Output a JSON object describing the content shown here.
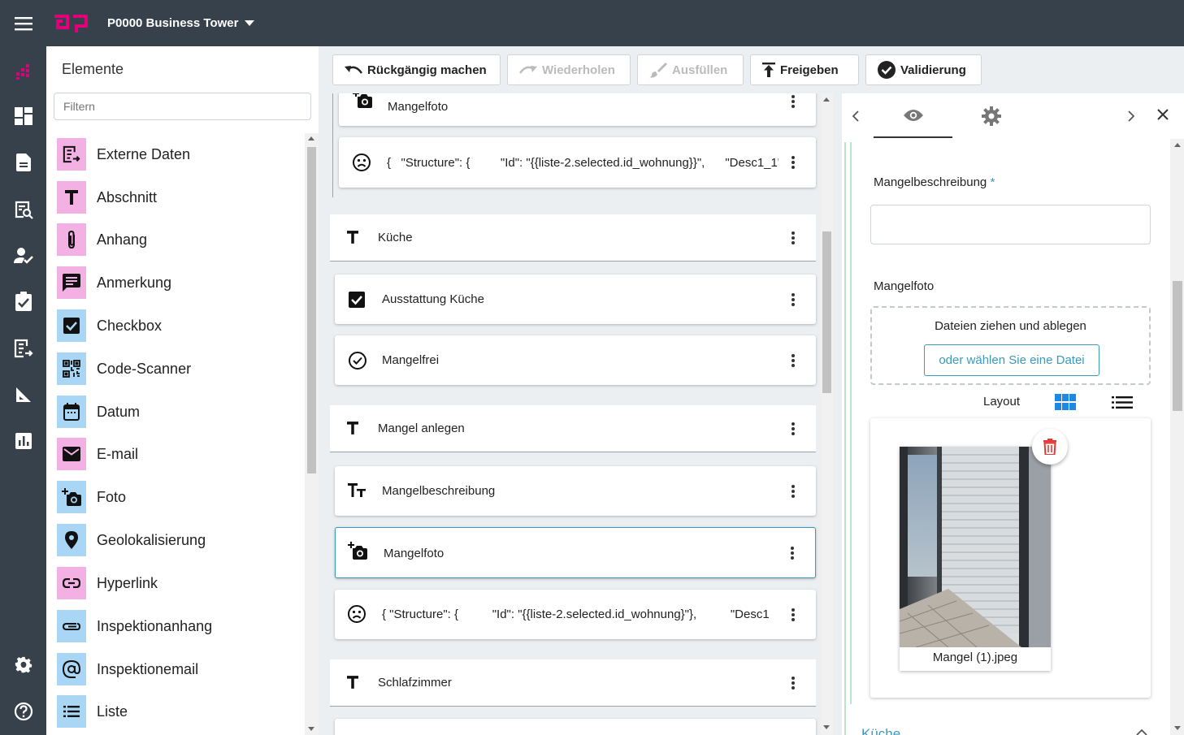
{
  "header": {
    "project": "P0000 Business Tower"
  },
  "elements_panel": {
    "title": "Elemente",
    "filter_placeholder": "Filtern",
    "items": [
      {
        "label": "Externe Daten",
        "icon": "external-data-icon",
        "color": "pink"
      },
      {
        "label": "Abschnitt",
        "icon": "text-t-icon",
        "color": "pink"
      },
      {
        "label": "Anhang",
        "icon": "paperclip-icon",
        "color": "pink"
      },
      {
        "label": "Anmerkung",
        "icon": "comment-icon",
        "color": "pink"
      },
      {
        "label": "Checkbox",
        "icon": "checkbox-icon",
        "color": "blue"
      },
      {
        "label": "Code-Scanner",
        "icon": "qr-code-icon",
        "color": "blue"
      },
      {
        "label": "Datum",
        "icon": "calendar-icon",
        "color": "blue"
      },
      {
        "label": "E-mail",
        "icon": "mail-icon",
        "color": "pink"
      },
      {
        "label": "Foto",
        "icon": "add-photo-icon",
        "color": "blue"
      },
      {
        "label": "Geolokalisierung",
        "icon": "map-pin-icon",
        "color": "blue"
      },
      {
        "label": "Hyperlink",
        "icon": "link-icon",
        "color": "pink"
      },
      {
        "label": "Inspektionanhang",
        "icon": "attachment-icon",
        "color": "blue"
      },
      {
        "label": "Inspektionemail",
        "icon": "at-icon",
        "color": "blue"
      },
      {
        "label": "Liste",
        "icon": "list-icon",
        "color": "blue"
      }
    ]
  },
  "toolbar": {
    "undo": "Rückgängig machen",
    "redo": "Wiederholen",
    "fill": "Ausfüllen",
    "release": "Freigeben",
    "validate": "Validierung"
  },
  "form": {
    "items": [
      {
        "label": "Mangelfoto",
        "icon": "add-photo-icon"
      },
      {
        "label": "{   \"Structure\": {         \"Id\": \"{{liste-2.selected.id_wohnung}}\",      \"Desc1_1\"",
        "icon": "sad-face-icon"
      },
      {
        "label": "Küche",
        "icon": "text-t-icon"
      },
      {
        "label": "Ausstattung Küche",
        "icon": "checkbox-icon"
      },
      {
        "label": "Mangelfrei",
        "icon": "check-circle-icon"
      },
      {
        "label": "Mangel anlegen",
        "icon": "text-t-icon"
      },
      {
        "label": "Mangelbeschreibung",
        "icon": "text-fields-icon"
      },
      {
        "label": "Mangelfoto",
        "icon": "add-photo-icon"
      },
      {
        "label": "{ \"Structure\": {          \"Id\": \"{{liste-2.selected.id_wohnung}\"},          \"Desc1",
        "icon": "sad-face-icon"
      },
      {
        "label": "Schlafzimmer",
        "icon": "text-t-icon"
      }
    ]
  },
  "properties": {
    "desc_label": "Mangelbeschreibung",
    "required_mark": "*",
    "photo_label": "Mangelfoto",
    "drop_text": "Dateien ziehen und ablegen",
    "choose_file": "oder wählen Sie eine Datei",
    "layout_label": "Layout",
    "image_caption": "Mangel (1).jpeg",
    "next_section": "Küche"
  },
  "colors": {
    "accent": "#3d9ab8",
    "rail": "#37414b",
    "brand": "#e2007a",
    "delete": "#e53935"
  }
}
